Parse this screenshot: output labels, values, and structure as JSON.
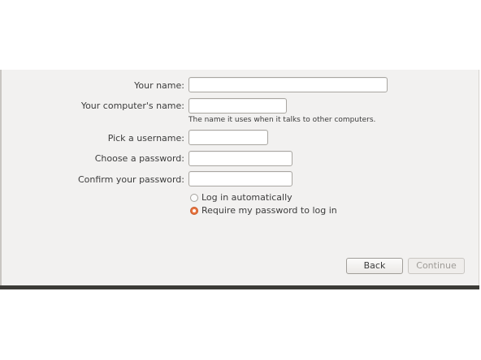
{
  "form": {
    "your_name": {
      "label": "Your name:",
      "value": ""
    },
    "computer_name": {
      "label": "Your computer's name:",
      "value": "",
      "hint": "The name it uses when it talks to other computers."
    },
    "username": {
      "label": "Pick a username:",
      "value": ""
    },
    "password": {
      "label": "Choose a password:",
      "value": ""
    },
    "confirm_password": {
      "label": "Confirm your password:",
      "value": ""
    }
  },
  "login_options": [
    {
      "label": "Log in automatically",
      "selected": false
    },
    {
      "label": "Require my password to log in",
      "selected": true
    }
  ],
  "buttons": {
    "back": "Back",
    "continue": "Continue"
  },
  "colors": {
    "accent": "#e8743f",
    "background": "#f2f1f0"
  }
}
